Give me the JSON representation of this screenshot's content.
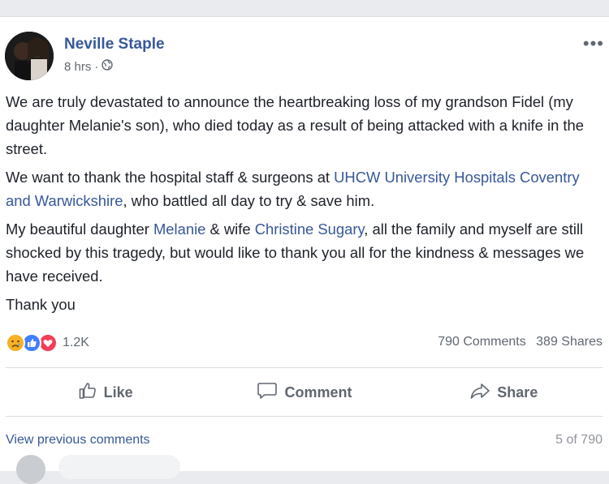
{
  "post": {
    "author": "Neville Staple",
    "time": "8 hrs",
    "more": "•••",
    "paragraphs": {
      "p1": "We are truly devastated to announce the heartbreaking loss of my grandson Fidel (my daughter Melanie's son), who died today as a result of being attacked with a knife in the street.",
      "p2_before": "We want to thank the hospital staff & surgeons at ",
      "p2_link": "UHCW University Hospitals Coventry and Warwickshire",
      "p2_after": ", who battled all day to try & save him.",
      "p3_before": "My beautiful daughter ",
      "p3_link1": "Melanie",
      "p3_mid": " & wife ",
      "p3_link2": "Christine Sugary",
      "p3_after": ", all the family and myself are still shocked by this tragedy, but would like to thank you all for the kindness & messages we have received.",
      "p4": "Thank you"
    },
    "reactions": {
      "count": "1.2K",
      "icons": [
        "sad-icon",
        "like-icon",
        "love-icon"
      ]
    },
    "comments_count": "790 Comments",
    "shares_count": "389 Shares",
    "actions": {
      "like": "Like",
      "comment": "Comment",
      "share": "Share"
    },
    "view_previous": "View previous comments",
    "page_count": "5 of 790"
  },
  "colors": {
    "link": "#365899",
    "muted": "#606770",
    "like": "#4080ff",
    "love": "#f33e58",
    "sad": "#f7b125"
  }
}
